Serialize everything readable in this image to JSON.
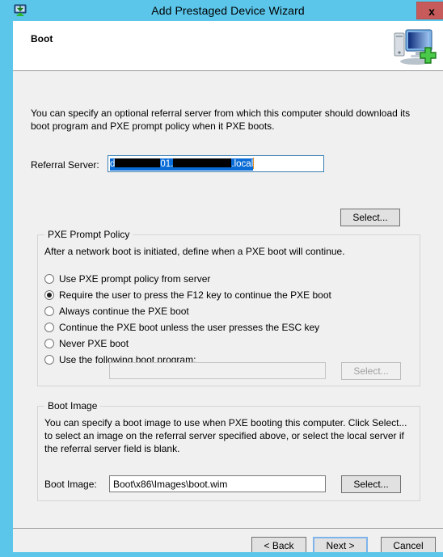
{
  "window": {
    "title": "Add Prestaged Device Wizard",
    "titlebar_icon": "computer-download-icon",
    "close_label": "x",
    "frame_color": "#5bc6ea",
    "close_color": "#c75b5b"
  },
  "header": {
    "title": "Boot",
    "icon": "computer-add-icon"
  },
  "page": {
    "intro": "You can specify an optional referral server from which this computer should download its boot program and PXE prompt policy when it PXE boots."
  },
  "referral": {
    "label": "Referral Server:",
    "value_visible_prefix": "d",
    "value_visible_middle": "01.",
    "value_visible_suffix": ".local",
    "redacted": true,
    "select_label": "Select...",
    "selected": true
  },
  "pxe_group": {
    "legend": "PXE Prompt Policy",
    "description": "After a network boot is initiated, define when a PXE boot will continue.",
    "options": [
      {
        "label": "Use PXE prompt policy from server",
        "checked": false
      },
      {
        "label": "Require the user to press the F12 key to continue the PXE boot",
        "checked": true
      },
      {
        "label": "Always continue the PXE boot",
        "checked": false
      },
      {
        "label": "Continue the PXE boot unless the user presses the ESC key",
        "checked": false
      },
      {
        "label": "Never PXE boot",
        "checked": false
      },
      {
        "label": "Use the following boot program:",
        "checked": false
      }
    ],
    "boot_program_value": "",
    "boot_program_select_label": "Select...",
    "boot_program_enabled": false
  },
  "bootimage_group": {
    "legend": "Boot Image",
    "description": "You can specify a boot image to use when PXE booting this computer. Click Select... to select an image on the referral server specified above, or select the local server if the referral server field is blank.",
    "field_label": "Boot Image:",
    "field_value": "Boot\\x86\\Images\\boot.wim",
    "select_label": "Select..."
  },
  "footer": {
    "back_label": "< Back",
    "next_label": "Next >",
    "cancel_label": "Cancel"
  }
}
